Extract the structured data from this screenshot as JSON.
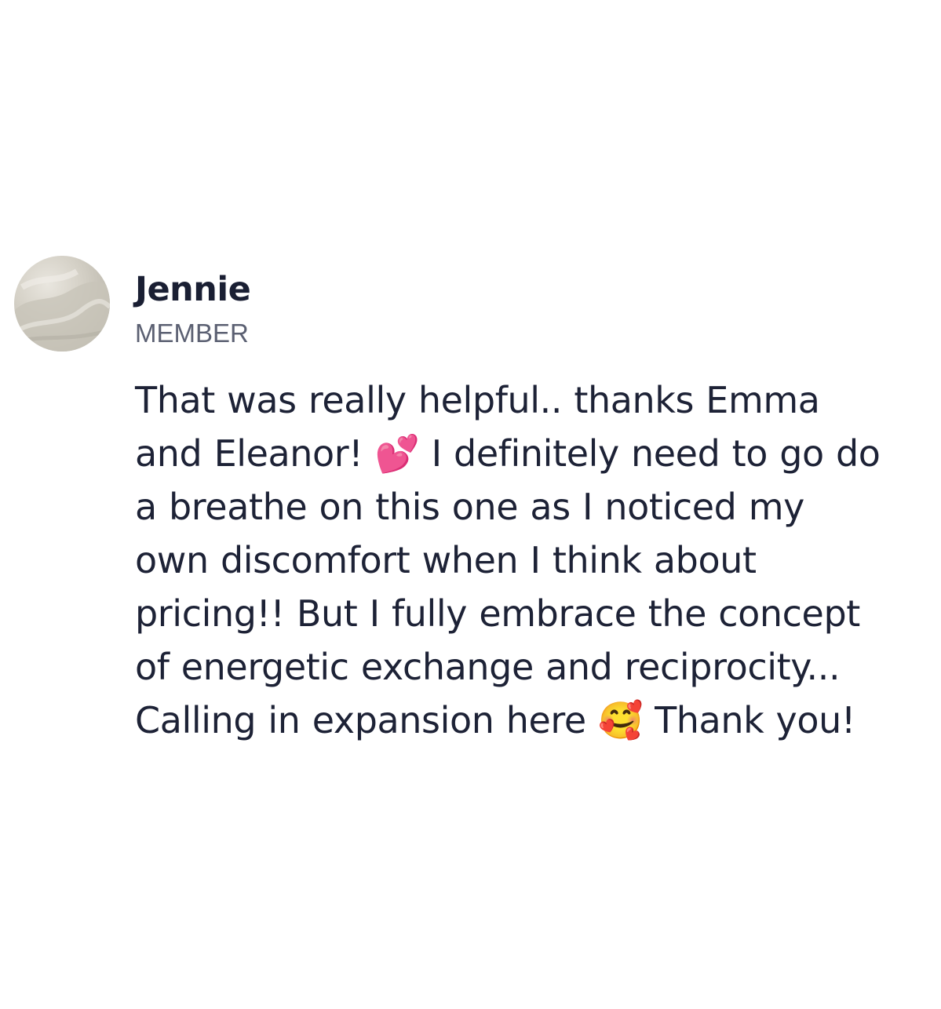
{
  "comment": {
    "author": {
      "name": "Jennie",
      "role": "MEMBER",
      "avatar_icon": "profile-photo"
    },
    "body_lines": [
      "That was really helpful.. thanks Emma",
      "and Eleanor! 💕 I definitely need to go do",
      "a breathe on this one as I noticed my",
      "own discomfort when I think about",
      "pricing!! But I fully embrace the concept",
      "of energetic exchange and reciprocity...",
      "Calling in expansion here 🥰 Thank you!"
    ]
  },
  "colors": {
    "text": "#1d2236",
    "role_text": "#5b6072",
    "background": "#ffffff"
  }
}
